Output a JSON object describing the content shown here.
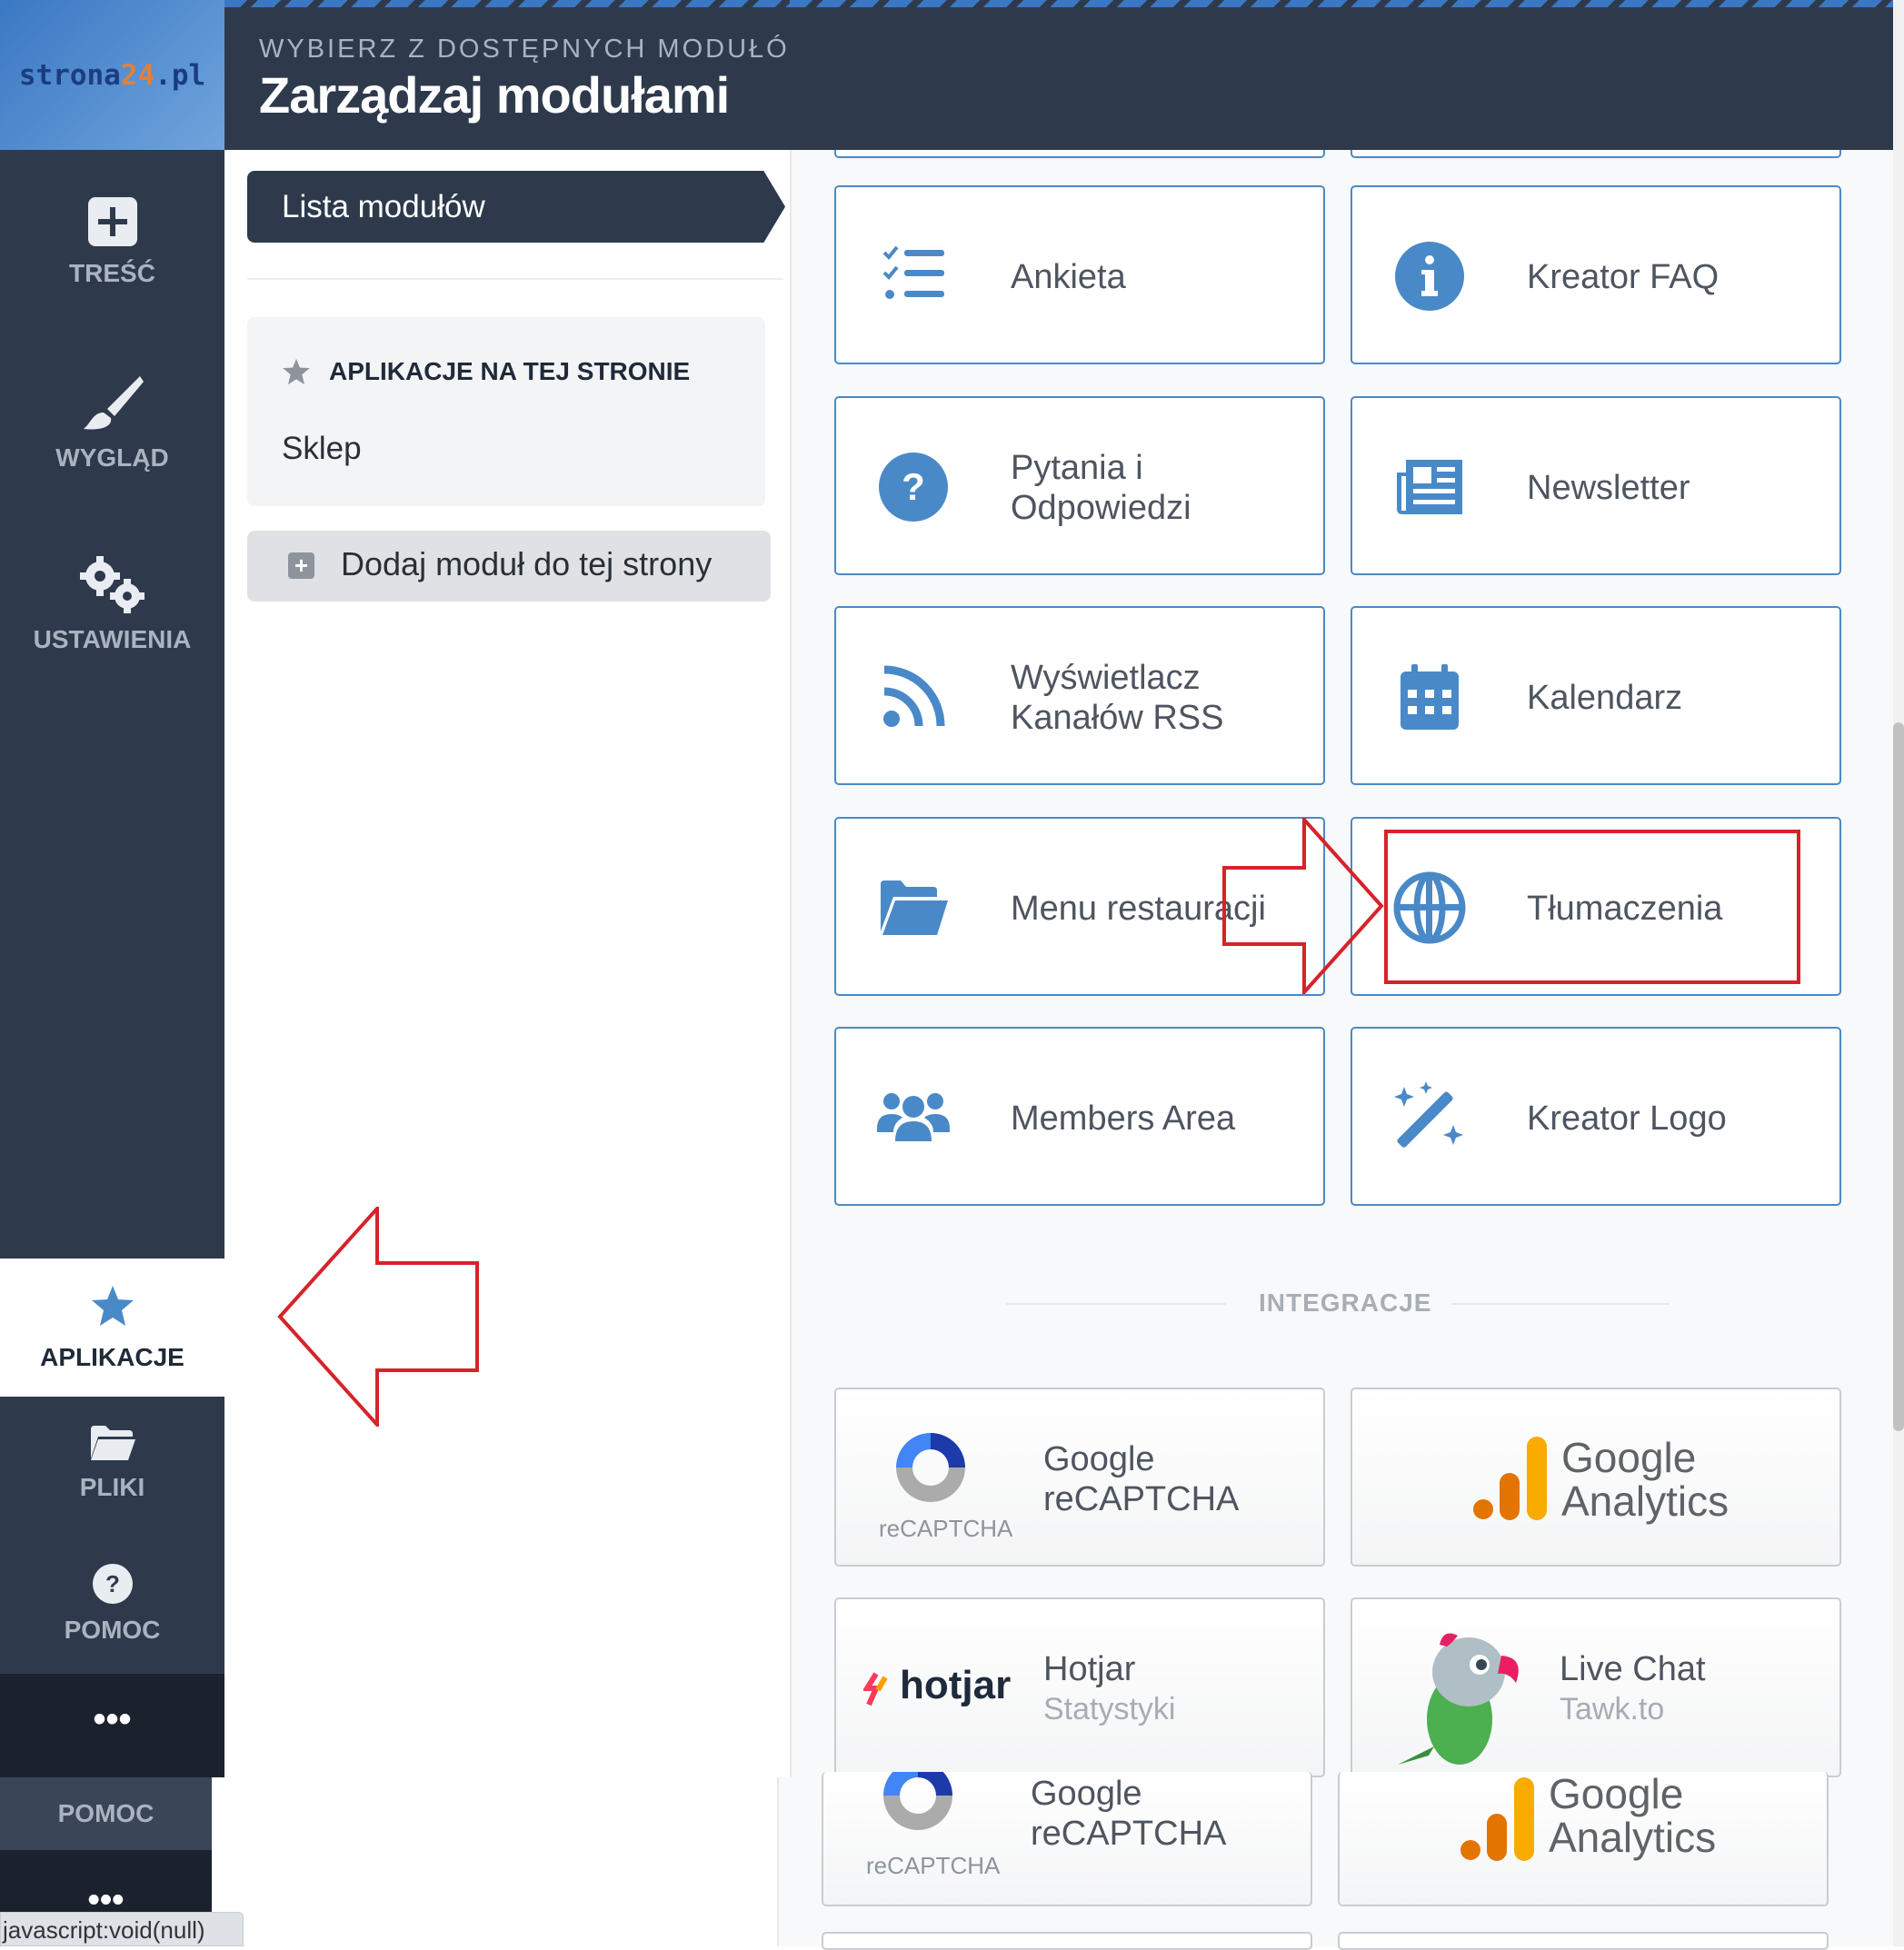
{
  "logo": {
    "part1": "strona",
    "part2": "24",
    "part3": ".pl"
  },
  "header": {
    "subtitle": "WYBIERZ Z DOSTĘPNYCH MODUŁÓW I APLIKACJI",
    "title": "Zarządzaj modułami"
  },
  "sidebar": {
    "items": [
      {
        "label": "TREŚĆ",
        "icon": "plus-square-icon"
      },
      {
        "label": "WYGLĄD",
        "icon": "paintbrush-icon"
      },
      {
        "label": "USTAWIENIA",
        "icon": "gears-icon"
      },
      {
        "label": "APLIKACJE",
        "icon": "star-icon",
        "active": true
      },
      {
        "label": "PLIKI",
        "icon": "folder-icon"
      },
      {
        "label": "POMOC",
        "icon": "question-circle-icon"
      }
    ],
    "more": "•••"
  },
  "left_panel": {
    "tab_label": "Lista modułów",
    "apps_heading": "APLIKACJE NA TEJ STRONIE",
    "apps_items": [
      "Sklep"
    ],
    "add_button": "Dodaj moduł do tej strony"
  },
  "modules": [
    {
      "label": "Ankieta",
      "icon": "checklist-icon"
    },
    {
      "label": "Kreator FAQ",
      "icon": "info-circle-icon"
    },
    {
      "label": "Pytania i Odpowiedzi",
      "icon": "question-circle-icon"
    },
    {
      "label": "Newsletter",
      "icon": "newspaper-icon"
    },
    {
      "label": "Wyświetlacz Kanałów RSS",
      "icon": "rss-icon"
    },
    {
      "label": "Kalendarz",
      "icon": "calendar-icon"
    },
    {
      "label": "Menu restauracji",
      "icon": "folder-open-icon"
    },
    {
      "label": "Tłumaczenia",
      "icon": "globe-icon"
    },
    {
      "label": "Members Area",
      "icon": "users-icon"
    },
    {
      "label": "Kreator Logo",
      "icon": "magic-wand-icon"
    }
  ],
  "integrations_heading": "INTEGRACJE",
  "integrations": [
    {
      "title": "Google",
      "title2": "reCAPTCHA",
      "logo_text": "reCAPTCHA"
    },
    {
      "title": "Google",
      "title2": "Analytics"
    },
    {
      "title": "Hotjar",
      "subtitle": "Statystyki",
      "logo_text": "hotjar"
    },
    {
      "title": "Live Chat",
      "subtitle": "Tawk.to"
    }
  ],
  "duplicate": {
    "pomoc": "POMOC",
    "dots": "•••",
    "recaptcha_title": "Google",
    "recaptcha_title2": "reCAPTCHA",
    "recaptcha_logo": "reCAPTCHA",
    "ga_title": "Google",
    "ga_title2": "Analytics"
  },
  "status_bar": "javascript:void(null)",
  "colors": {
    "sidebar": "#2e3a4c",
    "accent": "#4a89c8",
    "annotation": "#d6232a"
  }
}
